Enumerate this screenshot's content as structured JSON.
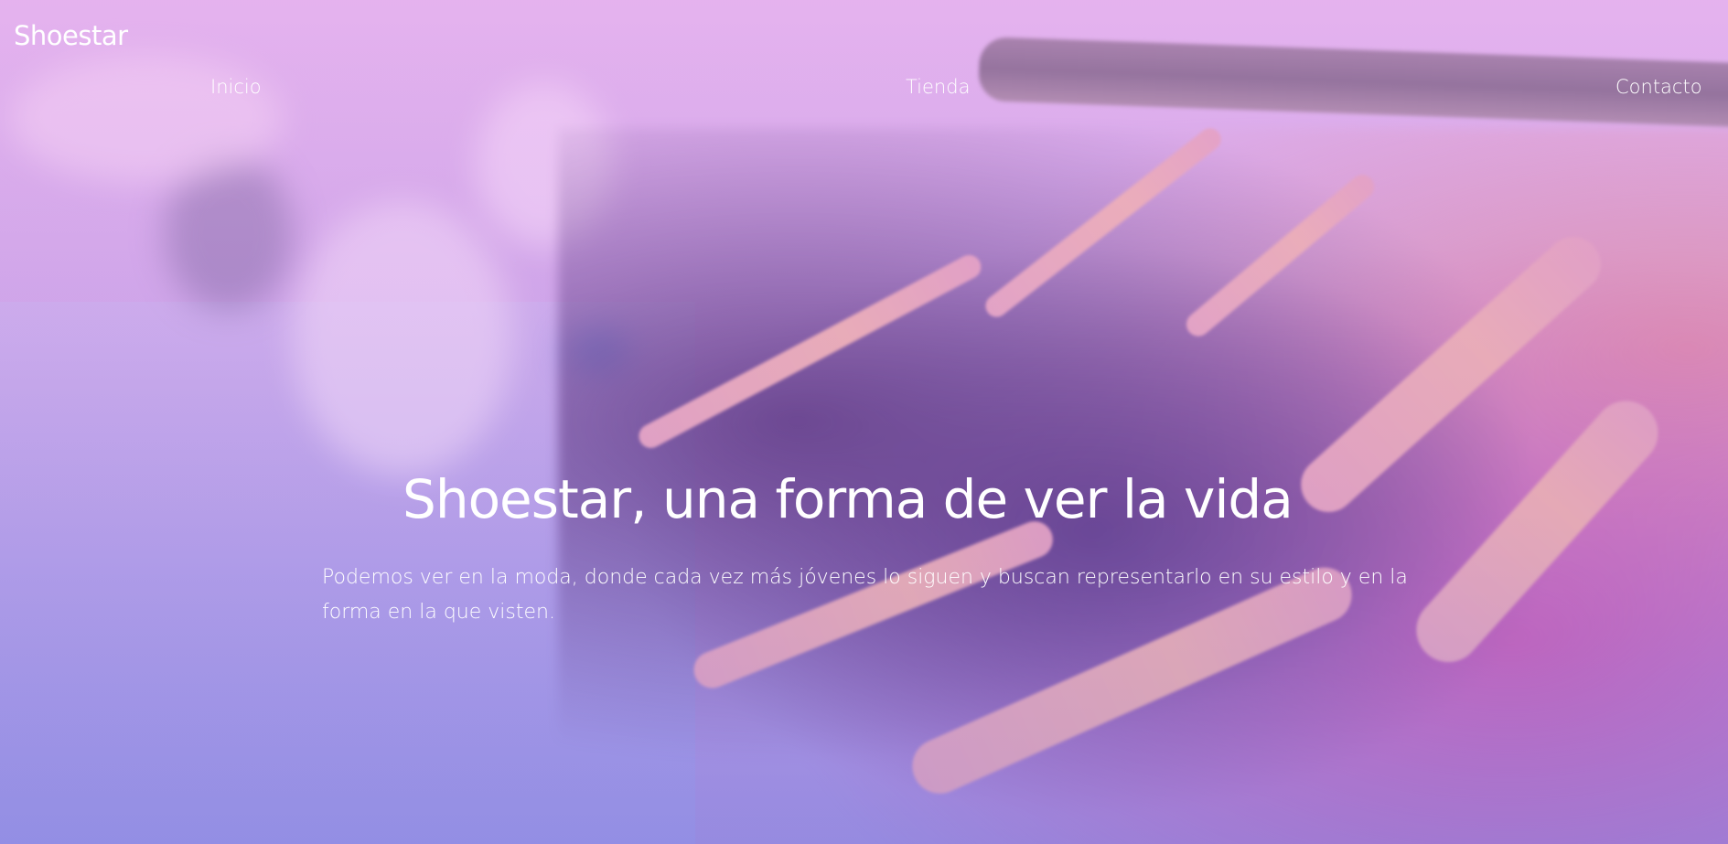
{
  "brand": {
    "name": "Shoestar"
  },
  "nav": {
    "items": [
      {
        "label": "Inicio"
      },
      {
        "label": "Tienda"
      },
      {
        "label": "Contacto"
      }
    ]
  },
  "hero": {
    "title": "Shoestar, una forma de ver la vida",
    "description": "Podemos ver en la moda, donde cada vez más jóvenes lo siguen y buscan representarlo en su estilo y en la forma en la que visten.",
    "background_image": "clothing-rack-photo",
    "overlay_colors": [
      "#e3b7f0",
      "#9b8fe0"
    ]
  }
}
